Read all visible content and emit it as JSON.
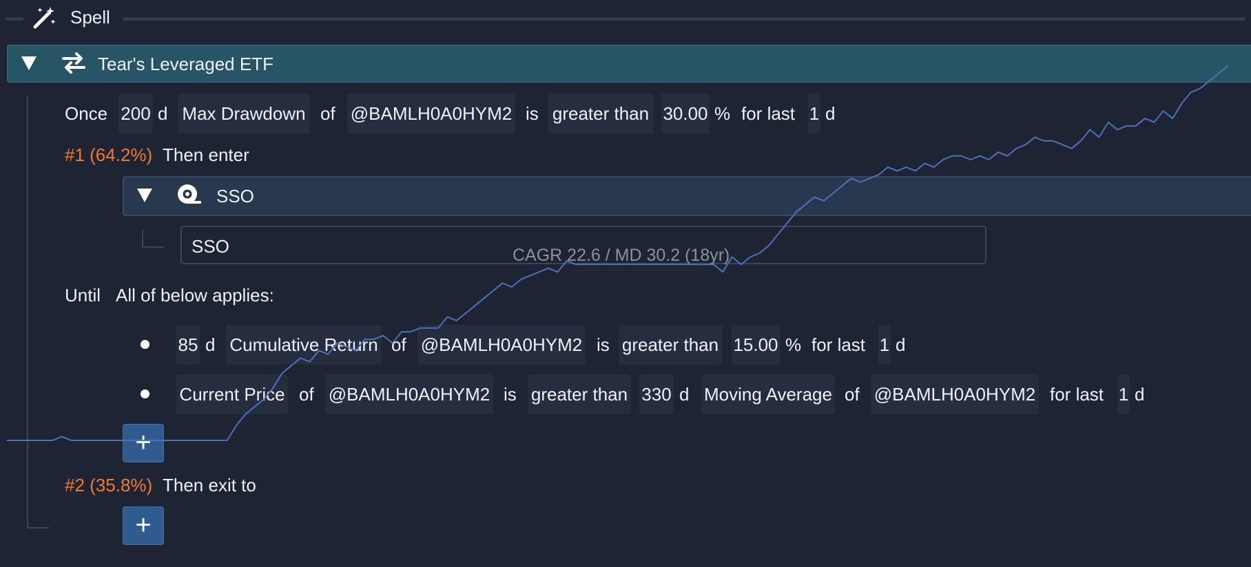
{
  "spell": {
    "label": "Spell"
  },
  "strategy": {
    "title": "Tear's Leveraged ETF"
  },
  "once": {
    "word": "Once",
    "window": "200",
    "window_unit": "d",
    "metric": "Max Drawdown",
    "of": "of",
    "ticker": "@BAMLH0A0HYM2",
    "is": "is",
    "comparator": "greater than",
    "threshold": "30.00",
    "threshold_unit": "%",
    "for_last": "for last",
    "duration": "1",
    "duration_unit": "d"
  },
  "branch1": {
    "label": "#1 (64.2%)",
    "action": "Then enter"
  },
  "asset": {
    "group_label": "SSO",
    "ticker_value": "SSO"
  },
  "until": {
    "word": "Until",
    "scope": "All of below applies:"
  },
  "conditions": [
    {
      "window": "85",
      "window_unit": "d",
      "metric": "Cumulative Return",
      "of": "of",
      "ticker": "@BAMLH0A0HYM2",
      "is": "is",
      "comparator": "greater than",
      "threshold": "15.00",
      "threshold_unit": "%",
      "for_last": "for last",
      "duration": "1",
      "duration_unit": "d"
    },
    {
      "metric": "Current Price",
      "of": "of",
      "ticker": "@BAMLH0A0HYM2",
      "is": "is",
      "comparator": "greater than",
      "window": "330",
      "window_unit": "d",
      "ma": "Moving Average",
      "of2": "of",
      "ticker2": "@BAMLH0A0HYM2",
      "for_last": "for last",
      "duration": "1",
      "duration_unit": "d"
    }
  ],
  "add_button": {
    "symbol": "+"
  },
  "branch2": {
    "label": "#2 (35.8%)",
    "action": "Then exit to"
  },
  "overlay": {
    "summary": "CAGR 22.6 / MD 30.2 (18yr)"
  },
  "colors": {
    "accent_orange": "#f07a2c",
    "curve": "#4a73b8",
    "bar_teal": "#285565"
  },
  "icons": {
    "spell": "magic-wand-icon",
    "strategy": "swap-arrows-icon",
    "asset": "tape-icon"
  },
  "chart_data": {
    "type": "line",
    "title": "",
    "series": [
      {
        "values": [
          0.0,
          0.0,
          0.0,
          0.0,
          0.0,
          0.0,
          0.01,
          0.0,
          0.0,
          0.0,
          0.0,
          0.0,
          0.0,
          0.0,
          0.0,
          0.0,
          0.0,
          0.0,
          0.0,
          0.0,
          0.0,
          0.0,
          0.0,
          0.0,
          0.0,
          0.04,
          0.07,
          0.09,
          0.11,
          0.14,
          0.18,
          0.2,
          0.22,
          0.21,
          0.24,
          0.23,
          0.26,
          0.25,
          0.24,
          0.27,
          0.27,
          0.28,
          0.26,
          0.29,
          0.29,
          0.3,
          0.3,
          0.3,
          0.33,
          0.32,
          0.34,
          0.36,
          0.38,
          0.4,
          0.42,
          0.41,
          0.43,
          0.44,
          0.45,
          0.46,
          0.45,
          0.48,
          0.47,
          0.47,
          0.47,
          0.47,
          0.47,
          0.47,
          0.47,
          0.47,
          0.47,
          0.47,
          0.47,
          0.47,
          0.47,
          0.47,
          0.47,
          0.47,
          0.45,
          0.49,
          0.47,
          0.49,
          0.5,
          0.52,
          0.55,
          0.58,
          0.61,
          0.63,
          0.65,
          0.64,
          0.66,
          0.68,
          0.7,
          0.69,
          0.7,
          0.71,
          0.73,
          0.72,
          0.73,
          0.72,
          0.74,
          0.73,
          0.75,
          0.76,
          0.76,
          0.75,
          0.76,
          0.75,
          0.77,
          0.76,
          0.78,
          0.79,
          0.81,
          0.8,
          0.8,
          0.79,
          0.78,
          0.8,
          0.83,
          0.81,
          0.85,
          0.83,
          0.84,
          0.84,
          0.86,
          0.85,
          0.88,
          0.86,
          0.9,
          0.93,
          0.94,
          0.96,
          0.98,
          1.0
        ]
      }
    ]
  }
}
